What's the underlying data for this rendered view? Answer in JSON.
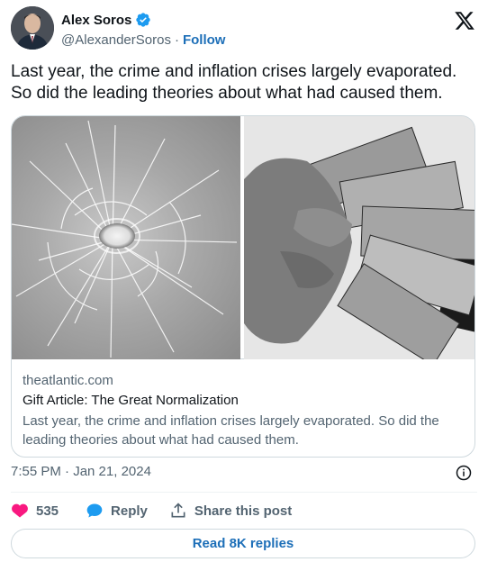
{
  "author": {
    "name": "Alex Soros",
    "handle": "@AlexanderSoros",
    "separator": "·",
    "follow_label": "Follow"
  },
  "tweet": {
    "text": "Last year, the crime and inflation crises largely evaporated. So did the leading theories about what had caused them.",
    "timestamp": "7:55 PM · Jan 21, 2024"
  },
  "card": {
    "domain": "theatlantic.com",
    "title": "Gift Article: The Great Normalization",
    "description": "Last year, the crime and inflation crises largely evaporated. So did the leading theories about what had caused them."
  },
  "actions": {
    "like_count": "535",
    "reply_label": "Reply",
    "share_label": "Share this post",
    "read_replies_label": "Read 8K replies"
  },
  "colors": {
    "like": "#f91880",
    "reply": "#1d9bf0",
    "link": "#1d6fb8",
    "muted": "#536471",
    "verified": "#1d9bf0"
  },
  "icons": [
    "avatar",
    "verified-badge-icon",
    "x-logo-icon",
    "info-icon",
    "heart-icon",
    "reply-bubble-icon",
    "share-icon"
  ]
}
